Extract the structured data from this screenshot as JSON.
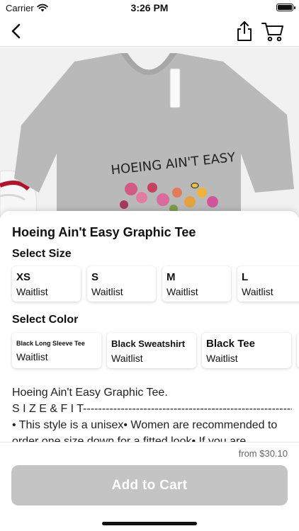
{
  "status": {
    "carrier": "Carrier",
    "time": "3:26 PM"
  },
  "product": {
    "title": "Hoeing Ain't Easy Graphic Tee",
    "shirt_text": "HOEING AIN'T EASY"
  },
  "size_section": {
    "label": "Select Size",
    "options": [
      {
        "name": "XS",
        "status": "Waitlist"
      },
      {
        "name": "S",
        "status": "Waitlist"
      },
      {
        "name": "M",
        "status": "Waitlist"
      },
      {
        "name": "L",
        "status": "Waitlist"
      }
    ]
  },
  "color_section": {
    "label": "Select Color",
    "options": [
      {
        "name": "Black Long Sleeve Tee",
        "status": "Waitlist"
      },
      {
        "name": "Black Sweatshirt",
        "status": "Waitlist"
      },
      {
        "name": "Black Tee",
        "status": "Waitlist"
      }
    ]
  },
  "description": {
    "line1": "Hoeing Ain't Easy Graphic Tee.",
    "line2": "S I Z E & F I T--------------------------------------------------------------",
    "line3": "• This style is a unisex• Women are recommended to",
    "line4": "order one size down for a fitted look• If you are"
  },
  "footer": {
    "price": "from $30.10",
    "add_button": "Add to Cart"
  },
  "colors": {
    "button_disabled": "#c4c4c4",
    "shirt": "#b7b7b7"
  }
}
